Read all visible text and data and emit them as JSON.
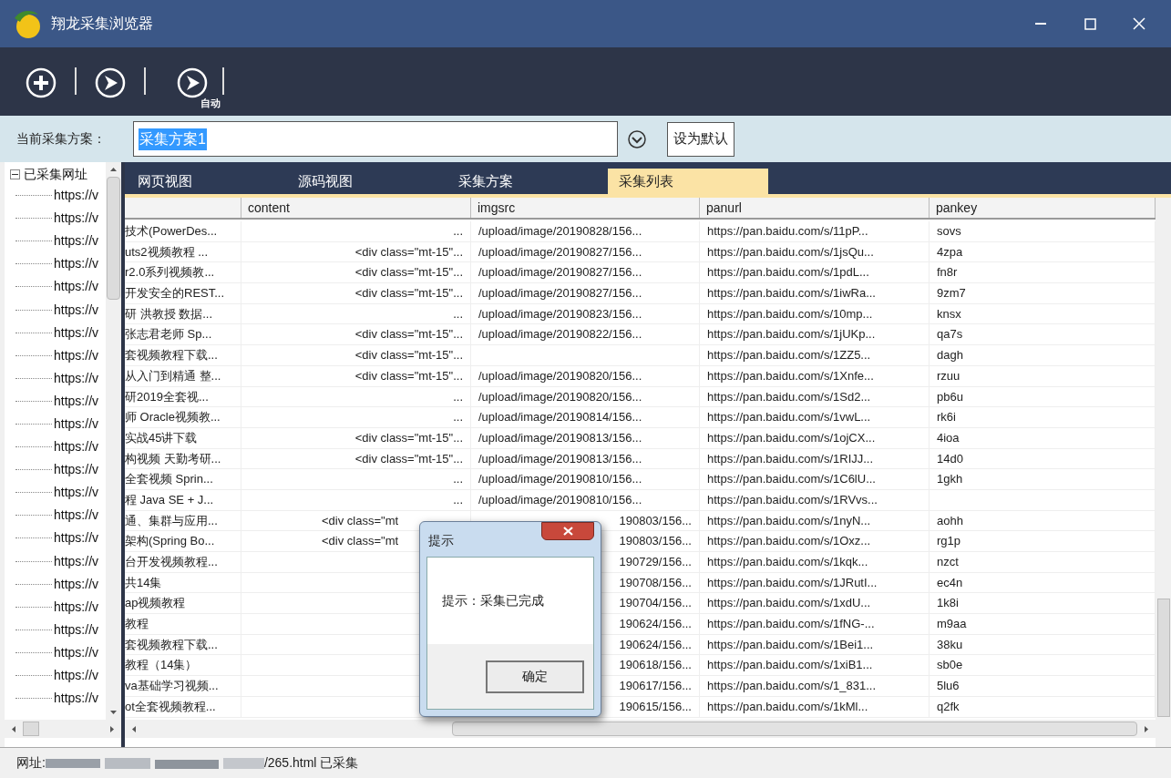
{
  "window": {
    "title": "翔龙采集浏览器"
  },
  "toolbar": {
    "auto_label": "自动"
  },
  "scheme": {
    "label": "当前采集方案：",
    "value": "采集方案1",
    "default_button": "设为默认"
  },
  "tree": {
    "root": "已采集网址",
    "expanded": true,
    "children": [
      "https://v",
      "https://v",
      "https://v",
      "https://v",
      "https://v",
      "https://v",
      "https://v",
      "https://v",
      "https://v",
      "https://v",
      "https://v",
      "https://v",
      "https://v",
      "https://v",
      "https://v",
      "https://v",
      "https://v",
      "https://v",
      "https://v",
      "https://v",
      "https://v",
      "https://v",
      "https://v"
    ]
  },
  "tabs": [
    {
      "label": "网页视图",
      "selected": false
    },
    {
      "label": "源码视图",
      "selected": false
    },
    {
      "label": "采集方案",
      "selected": false
    },
    {
      "label": "采集列表",
      "selected": true
    }
  ],
  "table": {
    "columns": [
      "content",
      "imgsrc",
      "panurl",
      "pankey"
    ],
    "rows": [
      {
        "kind": "full",
        "column_1": "技术(PowerDes...",
        "content": "...",
        "imgsrc": "/upload/image/20190828/156...",
        "panurl": "https://pan.baidu.com/s/11pP...",
        "pankey": "sovs"
      },
      {
        "kind": "full",
        "column_1": "uts2视频教程 ...",
        "content": "<div class=\"mt-15\"...",
        "imgsrc": "/upload/image/20190827/156...",
        "panurl": "https://pan.baidu.com/s/1jsQu...",
        "pankey": "4zpa"
      },
      {
        "kind": "full",
        "column_1": "r2.0系列视频教...",
        "content": "<div class=\"mt-15\"...",
        "imgsrc": "/upload/image/20190827/156...",
        "panurl": "https://pan.baidu.com/s/1pdL...",
        "pankey": "fn8r"
      },
      {
        "kind": "full",
        "column_1": "开发安全的REST...",
        "content": "<div class=\"mt-15\"...",
        "imgsrc": "/upload/image/20190827/156...",
        "panurl": "https://pan.baidu.com/s/1iwRa...",
        "pankey": "9zm7"
      },
      {
        "kind": "full",
        "column_1": "研 洪教授 数据...",
        "content": "...",
        "imgsrc": "/upload/image/20190823/156...",
        "panurl": "https://pan.baidu.com/s/10mp...",
        "pankey": "knsx"
      },
      {
        "kind": "full",
        "column_1": "张志君老师 Sp...",
        "content": "<div class=\"mt-15\"...",
        "imgsrc": "/upload/image/20190822/156...",
        "panurl": "https://pan.baidu.com/s/1jUKp...",
        "pankey": "qa7s"
      },
      {
        "kind": "full",
        "column_1": "套视频教程下载...",
        "content": "<div class=\"mt-15\"...",
        "panurl": "https://pan.baidu.com/s/1ZZ5...",
        "pankey": "dagh"
      },
      {
        "kind": "full",
        "column_1": "从入门到精通 整...",
        "content": "<div class=\"mt-15\"...",
        "imgsrc": "/upload/image/20190820/156...",
        "panurl": "https://pan.baidu.com/s/1Xnfe...",
        "pankey": "rzuu"
      },
      {
        "kind": "full",
        "column_1": "研2019全套视...",
        "content": "...",
        "imgsrc": "/upload/image/20190820/156...",
        "panurl": "https://pan.baidu.com/s/1Sd2...",
        "pankey": "pb6u"
      },
      {
        "kind": "full",
        "column_1": "师 Oracle视频教...",
        "content": "...",
        "imgsrc": "/upload/image/20190814/156...",
        "panurl": "https://pan.baidu.com/s/1vwL...",
        "pankey": "rk6i"
      },
      {
        "kind": "full",
        "column_1": "实战45讲下载",
        "content": "<div class=\"mt-15\"...",
        "imgsrc": "/upload/image/20190813/156...",
        "panurl": "https://pan.baidu.com/s/1ojCX...",
        "pankey": "4ioa"
      },
      {
        "kind": "full",
        "column_1": "构视频 天勤考研...",
        "content": "<div class=\"mt-15\"...",
        "imgsrc": "/upload/image/20190813/156...",
        "panurl": "https://pan.baidu.com/s/1RIJJ...",
        "pankey": "14d0"
      },
      {
        "kind": "full",
        "column_1": "全套视频 Sprin...",
        "content": "...",
        "imgsrc": "/upload/image/20190810/156...",
        "panurl": "https://pan.baidu.com/s/1C6lU...",
        "pankey": "1gkh"
      },
      {
        "kind": "full",
        "column_1": "程 Java SE + J...",
        "content": "...",
        "imgsrc": "/upload/image/20190810/156...",
        "panurl": "https://pan.baidu.com/s/1RVvs..."
      },
      {
        "kind": "under_dialog",
        "column_1": "通、集群与应用...",
        "content": "<div class=\"mt",
        "imgsrc": "190803/156...",
        "panurl": "https://pan.baidu.com/s/1nyN...",
        "pankey": "aohh"
      },
      {
        "kind": "under_dialog",
        "column_1": "架构(Spring Bo...",
        "content": "<div class=\"mt",
        "imgsrc": "190803/156...",
        "panurl": "https://pan.baidu.com/s/1Oxz...",
        "pankey": "rg1p"
      },
      {
        "kind": "under_dialog",
        "column_1": "台开发视频教程...",
        "imgsrc": "190729/156...",
        "panurl": "https://pan.baidu.com/s/1kqk...",
        "pankey": "nzct"
      },
      {
        "kind": "under_dialog",
        "column_1": "共14集",
        "imgsrc": "190708/156...",
        "panurl": "https://pan.baidu.com/s/1JRutI...",
        "pankey": "ec4n"
      },
      {
        "kind": "under_dialog",
        "column_1": "ap视频教程",
        "imgsrc": "190704/156...",
        "panurl": "https://pan.baidu.com/s/1xdU...",
        "pankey": "1k8i"
      },
      {
        "kind": "under_dialog",
        "column_1": "教程",
        "imgsrc": "190624/156...",
        "panurl": "https://pan.baidu.com/s/1fNG-...",
        "pankey": "m9aa"
      },
      {
        "kind": "under_dialog",
        "column_1": "套视频教程下载...",
        "imgsrc": "190624/156...",
        "panurl": "https://pan.baidu.com/s/1Bei1...",
        "pankey": "38ku"
      },
      {
        "kind": "under_dialog",
        "column_1": "教程（14集）",
        "imgsrc": "190618/156...",
        "panurl": "https://pan.baidu.com/s/1xiB1...",
        "pankey": "sb0e"
      },
      {
        "kind": "under_dialog",
        "column_1": "va基础学习视频...",
        "imgsrc": "190617/156...",
        "panurl": "https://pan.baidu.com/s/1_831...",
        "pankey": "5lu6"
      },
      {
        "kind": "under_dialog",
        "column_1": "ot全套视频教程...",
        "imgsrc": "190615/156...",
        "panurl": "https://pan.baidu.com/s/1kMl...",
        "pankey": "q2fk"
      }
    ]
  },
  "dialog": {
    "title": "提示",
    "message": "提示：采集已完成",
    "button": "确定"
  },
  "status_bar": {
    "prefix": "网址:",
    "suffix": "/265.html 已采集"
  }
}
